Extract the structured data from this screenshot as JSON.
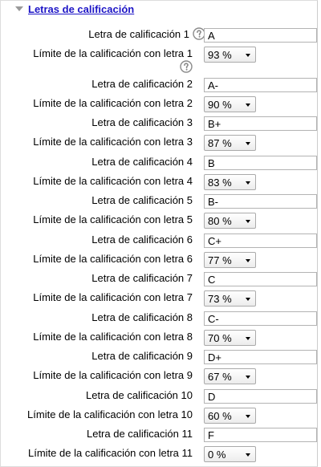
{
  "section": {
    "title": "Letras de calificación"
  },
  "grade_letters": [
    {
      "letter_label": "Letra de calificación 1",
      "letter_value": "A",
      "limit_label": "Límite de la calificación con letra 1",
      "limit_value": "93 %"
    },
    {
      "letter_label": "Letra de calificación 2",
      "letter_value": "A-",
      "limit_label": "Límite de la calificación con letra 2",
      "limit_value": "90 %"
    },
    {
      "letter_label": "Letra de calificación 3",
      "letter_value": "B+",
      "limit_label": "Límite de la calificación con letra 3",
      "limit_value": "87 %"
    },
    {
      "letter_label": "Letra de calificación 4",
      "letter_value": "B",
      "limit_label": "Límite de la calificación con letra 4",
      "limit_value": "83 %"
    },
    {
      "letter_label": "Letra de calificación 5",
      "letter_value": "B-",
      "limit_label": "Límite de la calificación con letra 5",
      "limit_value": "80 %"
    },
    {
      "letter_label": "Letra de calificación 6",
      "letter_value": "C+",
      "limit_label": "Límite de la calificación con letra 6",
      "limit_value": "77 %"
    },
    {
      "letter_label": "Letra de calificación 7",
      "letter_value": "C",
      "limit_label": "Límite de la calificación con letra 7",
      "limit_value": "73 %"
    },
    {
      "letter_label": "Letra de calificación 8",
      "letter_value": "C-",
      "limit_label": "Límite de la calificación con letra 8",
      "limit_value": "70 %"
    },
    {
      "letter_label": "Letra de calificación 9",
      "letter_value": "D+",
      "limit_label": "Límite de la calificación con letra 9",
      "limit_value": "67 %"
    },
    {
      "letter_label": "Letra de calificación 10",
      "letter_value": "D",
      "limit_label": "Límite de la calificación con letra 10",
      "limit_value": "60 %"
    },
    {
      "letter_label": "Letra de calificación 11",
      "letter_value": "F",
      "limit_label": "Límite de la calificación con letra 11",
      "limit_value": "0 %"
    }
  ],
  "icons": {
    "help": "help-icon",
    "collapse": "collapse-triangle-icon",
    "dropdown": "dropdown-arrow-icon"
  },
  "colors": {
    "legend_text": "#1d15c6",
    "input_border": "#b3b3b3",
    "panel_border": "#dddddd"
  }
}
